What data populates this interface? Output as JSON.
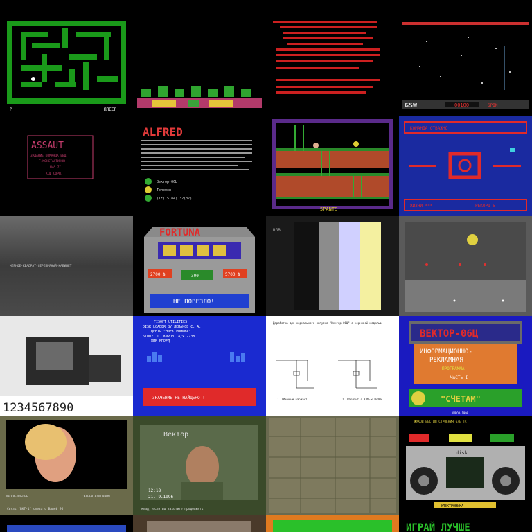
{
  "tiles": {
    "r1c2": {},
    "r1c4": {
      "logo": "GSW",
      "score": "00100",
      "lives": "SPIN"
    },
    "r2c1": {
      "title": "ASSAUT",
      "line1": "ЗАДАНИЕ КОМАНДА ВВЦ",
      "line2": "Г.КОНСТАНТИНОВ",
      "line3": "Н/А 7/",
      "copy": "КСШ СОРП."
    },
    "r2c2": {
      "title": "ALFRED",
      "text": "Вектор-06Ц",
      "phone1": "Телефон",
      "addr": "(1*) 5(84) 32(37)"
    },
    "r2c3": {
      "status": "5PANTS"
    },
    "r2c4": {
      "top": "КОМАНДА ОТВАЖНО",
      "bottom1": "ЖИЗНИ ***",
      "bottom2": "РЕКОРД 5"
    },
    "r3c1": {
      "text": "ЧЕРНОЕ-КВАДРАТ-СЕРЕБРЯНЫЙ-КАБИНЕТ"
    },
    "r3c2": {
      "title": "FORTUNA",
      "left_val": "2700 $",
      "mid_val": "300",
      "right_val": "5700 $",
      "message": "НЕ ПОВЕЗЛО!"
    },
    "r3c3": {
      "label": "RGB"
    },
    "r4c1": {
      "digits": "1234567890"
    },
    "r4c2": {
      "header1": "FISOFT UTILITIES",
      "header2": "DISK LOADER BY ЛЕПАКОВ С. А.",
      "header3": "ЦЕНТР \"ЭЛЕКТРОНИКА\"",
      "header4": "610021 Г. КИРОВ, А/Я 2738",
      "header5": "ЖИВ ВПРЕД",
      "message": "ЗНАЧЕНИЕ НЕ НАЙДЕНО !!!"
    },
    "r4c3": {
      "title": "Доработка для нормального запуска \"Вектор 06Ц\" с черновой моделью",
      "cap_left": "1. Обычный вариант",
      "cap_right": "2. Вариант с КОМ-SLIPPER"
    },
    "r4c4": {
      "title": "ВЕКТОР-06Ц",
      "sub1": "ИНФОРМАЦИОННО-",
      "sub2": "РЕКЛАМНАЯ",
      "sub3": "ПРОГРАММА",
      "part": "ЧАСТЬ I",
      "bottom": "\"СЧЕТАМ\"",
      "year": "КИРОВ-1990"
    },
    "r5c1": {
      "cap1": "МАСКИ-ЛЮБОВЬ",
      "cap2": "СКАНЕР-КОМПАНИЯ",
      "footer": "Связь \"ВКТ-1\" слева с Вашей 96"
    },
    "r5c2": {
      "logo": "Вектор",
      "time": "12:18",
      "date": "21. 9.1996",
      "footer": "клад, если вы захотите продолжить"
    },
    "r5c4": {
      "header": "ЖУКОВ ВЕСТИЯ СТРОЕНИЯ 6/Е ТС",
      "disk": "disk",
      "sub": "ЭЛЕКТРОНИКА"
    },
    "r6c4": {
      "text": "ИГРАЙ ЛУЧШЕ"
    }
  }
}
